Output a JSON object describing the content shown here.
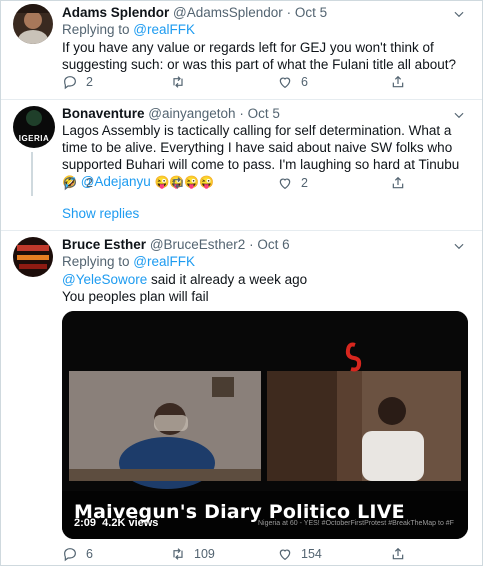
{
  "tweets": [
    {
      "name": "Adams Splendor",
      "handle": "@AdamsSplendor",
      "dot": "·",
      "time": "Oct 5",
      "replying_prefix": "Replying to ",
      "replying_to": "@realFFK",
      "text": "If you have any value or regards left for GEJ you won't think of suggesting such: or was this part of what the Fulani title all about?",
      "replies": "2",
      "retweets": "",
      "likes": "6"
    },
    {
      "name": "Bonaventure",
      "handle": "@ainyangetoh",
      "dot": "·",
      "time": "Oct 5",
      "text_main": "Lagos Assembly is tactically calling for self determination. What a time to be alive. Everything I have said about naive SW folks who supported Buhari will come to pass. I'm laughing so hard at Tinubu ",
      "text_emoji": "🤣",
      "text_mention": "@Adejanyu",
      "text_end_emoji": "😜😜😜😜",
      "replies": "2",
      "retweets": "",
      "likes": "2",
      "avatar_text": "IGERIA"
    },
    {
      "name": "Bruce Esther",
      "handle": "@BruceEsther2",
      "dot": "·",
      "time": "Oct 6",
      "replying_prefix": "Replying to ",
      "replying_to": "@realFFK",
      "text_mention": "@YeleSowore",
      "text_line1_rest": " said it already a week ago",
      "text_line2": "You peoples plan will fail",
      "replies": "6",
      "retweets": "109",
      "likes": "154"
    }
  ],
  "show_replies": "Show replies",
  "video": {
    "title": "Maivegun's Diary Politico LIVE",
    "duration": "2:09",
    "views": "4.2K views",
    "ticker": "Nigeria at 60 - YES! #OctoberFirstProtest #BreakTheMap to #F"
  },
  "colors": {
    "accent": "#1d9bf0",
    "secondary_text": "#536471",
    "divider": "#e6ecf0"
  }
}
